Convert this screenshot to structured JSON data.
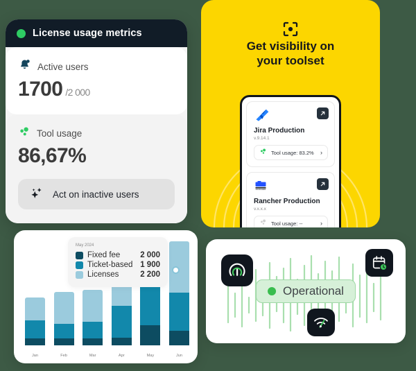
{
  "theme": {
    "page_background": "#3d5a45",
    "accent_yellow": "#fcd600",
    "accent_green": "#2ecc63",
    "dark": "#111c27"
  },
  "license_card": {
    "header": {
      "title": "License usage metrics",
      "status_dot_color": "#2ecc63"
    },
    "active_users": {
      "icon": "bell-badge-icon",
      "label": "Active users",
      "value": "1700",
      "limit": "/2 000"
    },
    "tool_usage": {
      "icon": "dots-cluster-icon",
      "label": "Tool usage",
      "value": "86,67%"
    },
    "action_button": {
      "icon": "sparkles-icon",
      "label": "Act on inactive users"
    }
  },
  "visibility_card": {
    "icon": "focus-scan-icon",
    "title": "Get visibility on\nyour toolset",
    "tools": [
      {
        "logo": "jira-logo",
        "name": "Jira Production",
        "version": "v.9.14.1",
        "usage": "Tool usage: 83.2%",
        "usage_active": true,
        "external_link_icon": "external-link-icon",
        "chevron": "›"
      },
      {
        "logo": "rancher-logo",
        "name": "Rancher Production",
        "version": "v.x.x.x",
        "usage": "Tool usage: --",
        "usage_active": false,
        "external_link_icon": "external-link-icon",
        "chevron": "›"
      }
    ]
  },
  "chart_card": {
    "tooltip": {
      "date": "May 2024",
      "rows": [
        {
          "name": "Fixed fee",
          "value": "2 000",
          "color": "#0d4c61"
        },
        {
          "name": "Ticket-based",
          "value": "1 900",
          "color": "#1288ab"
        },
        {
          "name": "Licenses",
          "value": "2 200",
          "color": "#9bcbdd"
        }
      ]
    }
  },
  "chart_data": {
    "type": "bar",
    "title": "",
    "stacked": true,
    "categories": [
      "Jan",
      "Feb",
      "Mar",
      "Apr",
      "May",
      "Jun"
    ],
    "series": [
      {
        "name": "Fixed fee",
        "color": "#0d4c61",
        "values": [
          700,
          700,
          700,
          800,
          2000,
          1500
        ]
      },
      {
        "name": "Ticket-based",
        "color": "#1288ab",
        "values": [
          1800,
          1500,
          1700,
          3200,
          4800,
          3800
        ]
      },
      {
        "name": "Licenses",
        "color": "#9bcbdd",
        "values": [
          2300,
          3200,
          3200,
          3100,
          2200,
          5200
        ]
      }
    ],
    "xlabel": "",
    "ylabel": "",
    "ylim": [
      0,
      10500
    ],
    "grid": false,
    "legend": "tooltip",
    "highlight_category": "May",
    "units": "licenses"
  },
  "ops_card": {
    "status": {
      "label": "Operational",
      "dot_color": "#39bd4e"
    },
    "icons": [
      {
        "name": "gauge-icon"
      },
      {
        "name": "calendar-clock-icon"
      },
      {
        "name": "speed-meter-icon"
      }
    ]
  }
}
